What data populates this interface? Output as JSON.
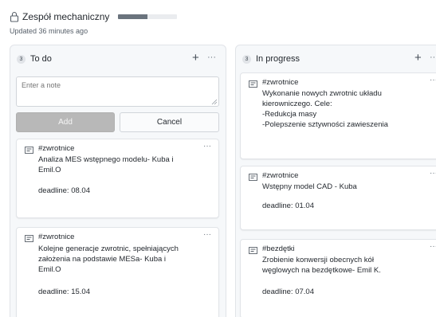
{
  "project": {
    "title": "Zespół mechaniczny",
    "updated": "Updated 36 minutes ago",
    "progress_fraction": 0.5
  },
  "columns": [
    {
      "name": "To do",
      "count": "3",
      "note_placeholder": "Enter a note",
      "add_label": "Add",
      "cancel_label": "Cancel",
      "cards": [
        {
          "tag": "#zwrotnice",
          "body": "Analiza MES wstępnego modelu- Kuba i\nEmil.O",
          "deadline": "deadline: 08.04"
        },
        {
          "tag": "#zwrotnice",
          "body": "Kolejne generacje zwrotnic, spełniających\nzałożenia na podstawie MESa- Kuba i\nEmil.O",
          "deadline": "deadline: 15.04"
        }
      ]
    },
    {
      "name": "In progress",
      "count": "3",
      "cards": [
        {
          "tag": "#zwrotnice",
          "body": "Wykonanie nowych zwrotnic układu\nkierowniczego. Cele:\n-Redukcja masy\n-Polepszenie sztywności zawieszenia",
          "deadline": ""
        },
        {
          "tag": "#zwrotnice",
          "body": "Wstępny model CAD - Kuba",
          "deadline": "deadline: 01.04"
        },
        {
          "tag": "#bezdętki",
          "body": "Zrobienie konwersji obecnych kół\nwęglowych na bezdętkowe- Emil K.",
          "deadline": "deadline: 07.04"
        }
      ]
    }
  ],
  "icons": {
    "lock": "lock-icon",
    "plus": "plus-icon",
    "more": "more-horizontal-icon",
    "note": "note-icon",
    "resize": "resize-grip-icon"
  },
  "colors": {
    "column_bg": "#f6f8fa",
    "border": "#e1e4e8",
    "add_button_disabled": "#b8b8b8",
    "progress_fill": "#6a737d"
  }
}
